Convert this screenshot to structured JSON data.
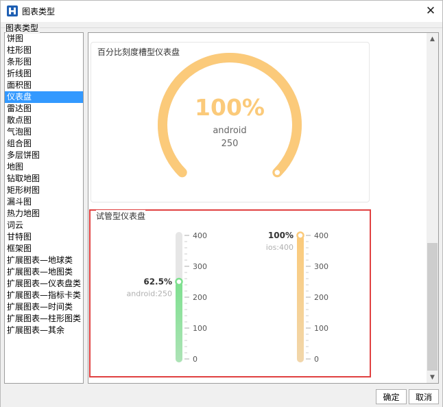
{
  "window": {
    "title": "图表类型",
    "close_symbol": "✕"
  },
  "group": {
    "label": "图表类型"
  },
  "chart_types": [
    {
      "label": "饼图",
      "selected": false
    },
    {
      "label": "柱形图",
      "selected": false
    },
    {
      "label": "条形图",
      "selected": false
    },
    {
      "label": "折线图",
      "selected": false
    },
    {
      "label": "面积图",
      "selected": false
    },
    {
      "label": "仪表盘",
      "selected": true
    },
    {
      "label": "雷达图",
      "selected": false
    },
    {
      "label": "散点图",
      "selected": false
    },
    {
      "label": "气泡图",
      "selected": false
    },
    {
      "label": "组合图",
      "selected": false
    },
    {
      "label": "多层饼图",
      "selected": false
    },
    {
      "label": "地图",
      "selected": false
    },
    {
      "label": "钻取地图",
      "selected": false
    },
    {
      "label": "矩形树图",
      "selected": false
    },
    {
      "label": "漏斗图",
      "selected": false
    },
    {
      "label": "热力地图",
      "selected": false
    },
    {
      "label": "词云",
      "selected": false
    },
    {
      "label": "甘特图",
      "selected": false
    },
    {
      "label": "框架图",
      "selected": false
    },
    {
      "label": "扩展图表—地球类",
      "selected": false
    },
    {
      "label": "扩展图表—地图类",
      "selected": false
    },
    {
      "label": "扩展图表—仪表盘类",
      "selected": false
    },
    {
      "label": "扩展图表—指标卡类",
      "selected": false
    },
    {
      "label": "扩展图表—时间类",
      "selected": false
    },
    {
      "label": "扩展图表—柱形图类",
      "selected": false
    },
    {
      "label": "扩展图表—其余",
      "selected": false
    }
  ],
  "gauges": {
    "percent_slot": {
      "title": "百分比刻度槽型仪表盘",
      "value_text": "100%",
      "category": "android",
      "value": "250",
      "percent": 1.0,
      "color": "#fbca7a"
    },
    "test_tube": {
      "title": "试管型仪表盘",
      "axis_ticks": [
        "400",
        "300",
        "200",
        "100",
        "0"
      ],
      "tubes": [
        {
          "percent_text": "62.5%",
          "label": "android:250",
          "value": 250,
          "max": 400,
          "color": "#7ee08f"
        },
        {
          "percent_text": "100%",
          "label": "ios:400",
          "value": 400,
          "max": 400,
          "color": "#fbca7a"
        }
      ]
    }
  },
  "buttons": {
    "ok": "确定",
    "cancel": "取消"
  },
  "colors": {
    "selection": "#3399ff",
    "highlight_border": "#e04040",
    "track": "#e6e6e6"
  }
}
